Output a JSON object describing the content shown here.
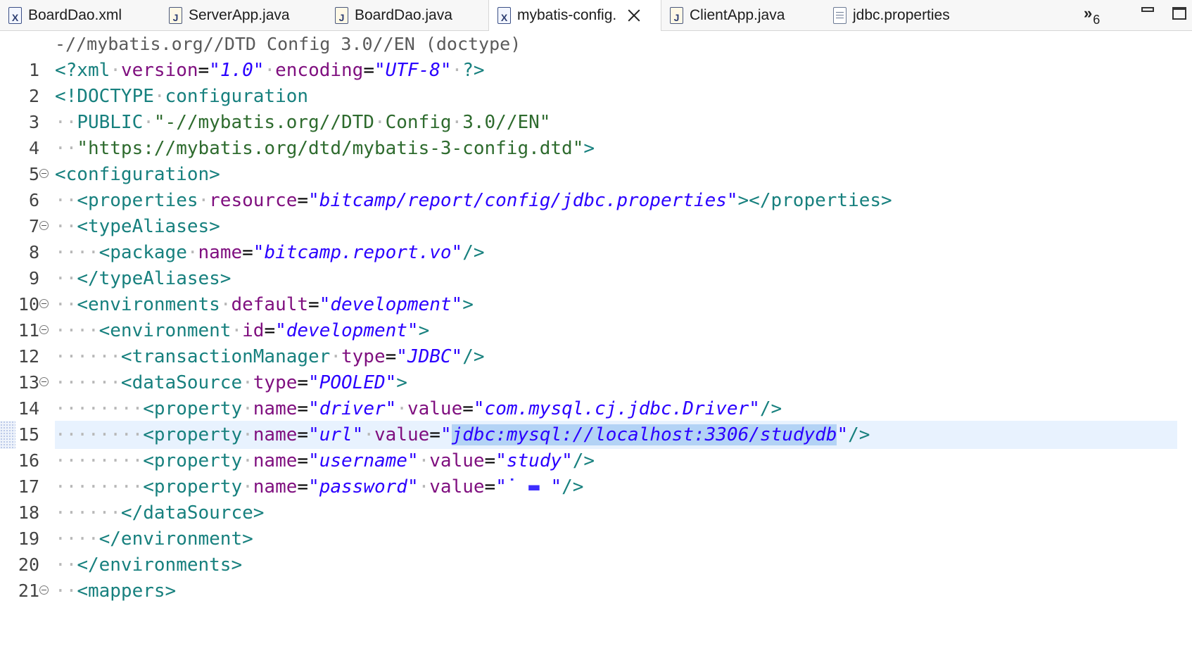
{
  "tabs": [
    {
      "label": "BoardDao.xml",
      "icon": "xml-file-icon",
      "kind": "xml",
      "active": false
    },
    {
      "label": "ServerApp.java",
      "icon": "java-file-icon",
      "kind": "java",
      "active": false
    },
    {
      "label": "BoardDao.java",
      "icon": "java-file-icon",
      "kind": "java",
      "active": false
    },
    {
      "label": "mybatis-config.",
      "icon": "xml-file-icon",
      "kind": "xml",
      "active": true
    },
    {
      "label": "ClientApp.java",
      "icon": "java-file-icon",
      "kind": "java",
      "active": false
    },
    {
      "label": "jdbc.properties",
      "icon": "properties-file-icon",
      "kind": "props",
      "active": false
    }
  ],
  "tab_overflow": {
    "symbol": "»",
    "count": "6"
  },
  "breadcrumb": "-//mybatis.org//DTD Config 3.0//EN (doctype)",
  "colors": {
    "tag": "#17807e",
    "attribute": "#7f0f7f",
    "value": "#2a00ff",
    "current_line": "#e8f2fe",
    "selection": "#b3d3f5"
  },
  "lines": [
    {
      "num": "1",
      "fold": false,
      "segs": [
        [
          "pi",
          "<?xml"
        ],
        [
          "ws",
          "·"
        ],
        [
          "at",
          "version"
        ],
        [
          "tx",
          "="
        ],
        [
          "st",
          "\"1.0\""
        ],
        [
          "ws",
          "·"
        ],
        [
          "at",
          "encoding"
        ],
        [
          "tx",
          "="
        ],
        [
          "st",
          "\"UTF-8\""
        ],
        [
          "ws",
          "·"
        ],
        [
          "pi",
          "?>"
        ]
      ]
    },
    {
      "num": "2",
      "fold": false,
      "segs": [
        [
          "dt",
          "<!DOCTYPE"
        ],
        [
          "ws",
          "·"
        ],
        [
          "dt",
          "configuration"
        ]
      ]
    },
    {
      "num": "3",
      "fold": false,
      "segs": [
        [
          "ws",
          "··"
        ],
        [
          "dt",
          "PUBLIC"
        ],
        [
          "ws",
          "·"
        ],
        [
          "ds",
          "\"-//mybatis.org//DTD"
        ],
        [
          "ws",
          "·"
        ],
        [
          "ds",
          "Config"
        ],
        [
          "ws",
          "·"
        ],
        [
          "ds",
          "3.0//EN\""
        ]
      ]
    },
    {
      "num": "4",
      "fold": false,
      "segs": [
        [
          "ws",
          "··"
        ],
        [
          "ds",
          "\"https://mybatis.org/dtd/mybatis-3-config.dtd\""
        ],
        [
          "dt",
          ">"
        ]
      ]
    },
    {
      "num": "5",
      "fold": true,
      "segs": [
        [
          "tg",
          "<configuration>"
        ]
      ]
    },
    {
      "num": "6",
      "fold": false,
      "segs": [
        [
          "ws",
          "··"
        ],
        [
          "tg",
          "<properties"
        ],
        [
          "ws",
          "·"
        ],
        [
          "at",
          "resource"
        ],
        [
          "tx",
          "="
        ],
        [
          "st",
          "\"bitcamp/report/config/jdbc.properties\""
        ],
        [
          "tg",
          "></properties>"
        ]
      ]
    },
    {
      "num": "7",
      "fold": true,
      "segs": [
        [
          "ws",
          "··"
        ],
        [
          "tg",
          "<typeAliases>"
        ]
      ]
    },
    {
      "num": "8",
      "fold": false,
      "segs": [
        [
          "ws",
          "····"
        ],
        [
          "tg",
          "<package"
        ],
        [
          "ws",
          "·"
        ],
        [
          "at",
          "name"
        ],
        [
          "tx",
          "="
        ],
        [
          "st",
          "\"bitcamp.report.vo\""
        ],
        [
          "tg",
          "/>"
        ]
      ]
    },
    {
      "num": "9",
      "fold": false,
      "segs": [
        [
          "ws",
          "··"
        ],
        [
          "tg",
          "</typeAliases>"
        ]
      ]
    },
    {
      "num": "10",
      "fold": true,
      "segs": [
        [
          "ws",
          "··"
        ],
        [
          "tg",
          "<environments"
        ],
        [
          "ws",
          "·"
        ],
        [
          "at",
          "default"
        ],
        [
          "tx",
          "="
        ],
        [
          "st",
          "\"development\""
        ],
        [
          "tg",
          ">"
        ]
      ]
    },
    {
      "num": "11",
      "fold": true,
      "segs": [
        [
          "ws",
          "····"
        ],
        [
          "tg",
          "<environment"
        ],
        [
          "ws",
          "·"
        ],
        [
          "at",
          "id"
        ],
        [
          "tx",
          "="
        ],
        [
          "st",
          "\"development\""
        ],
        [
          "tg",
          ">"
        ]
      ]
    },
    {
      "num": "12",
      "fold": false,
      "segs": [
        [
          "ws",
          "······"
        ],
        [
          "tg",
          "<transactionManager"
        ],
        [
          "ws",
          "·"
        ],
        [
          "at",
          "type"
        ],
        [
          "tx",
          "="
        ],
        [
          "st",
          "\"JDBC\""
        ],
        [
          "tg",
          "/>"
        ]
      ]
    },
    {
      "num": "13",
      "fold": true,
      "segs": [
        [
          "ws",
          "······"
        ],
        [
          "tg",
          "<dataSource"
        ],
        [
          "ws",
          "·"
        ],
        [
          "at",
          "type"
        ],
        [
          "tx",
          "="
        ],
        [
          "st",
          "\"POOLED\""
        ],
        [
          "tg",
          ">"
        ]
      ]
    },
    {
      "num": "14",
      "fold": false,
      "segs": [
        [
          "ws",
          "········"
        ],
        [
          "tg",
          "<property"
        ],
        [
          "ws",
          "·"
        ],
        [
          "at",
          "name"
        ],
        [
          "tx",
          "="
        ],
        [
          "st",
          "\"driver\""
        ],
        [
          "ws",
          "·"
        ],
        [
          "at",
          "value"
        ],
        [
          "tx",
          "="
        ],
        [
          "st",
          "\"com.mysql.cj.jdbc.Driver\""
        ],
        [
          "tg",
          "/>"
        ]
      ]
    },
    {
      "num": "15",
      "fold": false,
      "current": true,
      "segs": [
        [
          "ws",
          "········"
        ],
        [
          "tg",
          "<property"
        ],
        [
          "ws",
          "·"
        ],
        [
          "at",
          "name"
        ],
        [
          "tx",
          "="
        ],
        [
          "st",
          "\"url\""
        ],
        [
          "ws",
          "·"
        ],
        [
          "at",
          "value"
        ],
        [
          "tx",
          "="
        ],
        [
          "st",
          "\""
        ],
        [
          "sel",
          "jdbc:mysql://localhost:3306/studydb"
        ],
        [
          "st",
          "\""
        ],
        [
          "tg",
          "/>"
        ]
      ]
    },
    {
      "num": "16",
      "fold": false,
      "segs": [
        [
          "ws",
          "········"
        ],
        [
          "tg",
          "<property"
        ],
        [
          "ws",
          "·"
        ],
        [
          "at",
          "name"
        ],
        [
          "tx",
          "="
        ],
        [
          "st",
          "\"username\""
        ],
        [
          "ws",
          "·"
        ],
        [
          "at",
          "value"
        ],
        [
          "tx",
          "="
        ],
        [
          "st",
          "\"study\""
        ],
        [
          "tg",
          "/>"
        ]
      ]
    },
    {
      "num": "17",
      "fold": false,
      "segs": [
        [
          "ws",
          "········"
        ],
        [
          "tg",
          "<property"
        ],
        [
          "ws",
          "·"
        ],
        [
          "at",
          "name"
        ],
        [
          "tx",
          "="
        ],
        [
          "st",
          "\"password\""
        ],
        [
          "ws",
          "·"
        ],
        [
          "at",
          "value"
        ],
        [
          "tx",
          "="
        ],
        [
          "st",
          "\""
        ],
        [
          "mk",
          "˙ ▬ "
        ],
        [
          "st",
          "\""
        ],
        [
          "tg",
          "/>"
        ]
      ]
    },
    {
      "num": "18",
      "fold": false,
      "segs": [
        [
          "ws",
          "······"
        ],
        [
          "tg",
          "</dataSource>"
        ]
      ]
    },
    {
      "num": "19",
      "fold": false,
      "segs": [
        [
          "ws",
          "····"
        ],
        [
          "tg",
          "</environment>"
        ]
      ]
    },
    {
      "num": "20",
      "fold": false,
      "segs": [
        [
          "ws",
          "··"
        ],
        [
          "tg",
          "</environments>"
        ]
      ]
    },
    {
      "num": "21",
      "fold": true,
      "segs": [
        [
          "ws",
          "··"
        ],
        [
          "tg",
          "<mappers>"
        ]
      ]
    }
  ]
}
